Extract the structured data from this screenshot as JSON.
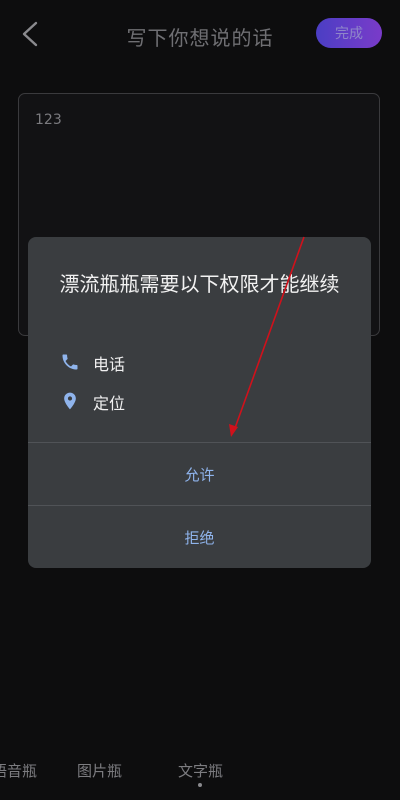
{
  "header": {
    "title": "写下你想说的话",
    "done_label": "完成",
    "back_icon": "chevron-left-icon"
  },
  "editor": {
    "value": "123"
  },
  "dialog": {
    "title": "漂流瓶瓶需要以下权限才能继续",
    "permissions": [
      {
        "label": "电话",
        "icon": "phone-icon"
      },
      {
        "label": "定位",
        "icon": "location-pin-icon"
      }
    ],
    "allow_label": "允许",
    "deny_label": "拒绝"
  },
  "tabs": [
    {
      "label": "语音瓶"
    },
    {
      "label": "图片瓶"
    },
    {
      "label": "文字瓶"
    }
  ],
  "colors": {
    "accent": "#8fb4ec",
    "done_gradient_start": "#4b3ec4",
    "done_gradient_end": "#7a3bc9",
    "annotation_arrow": "#d0111b"
  }
}
